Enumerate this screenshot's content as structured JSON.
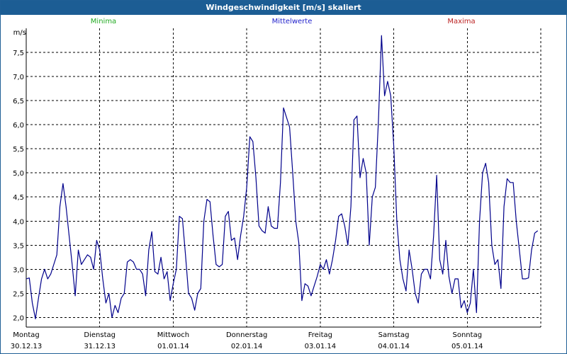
{
  "window": {
    "title": "Windgeschwindigkeit [m/s] skaliert"
  },
  "legend": [
    {
      "label": "Minima",
      "color": "#22aa22"
    },
    {
      "label": "Mittelwerte",
      "color": "#2222cc"
    },
    {
      "label": "Maxima",
      "color": "#bb2222"
    }
  ],
  "chart_data": {
    "type": "line",
    "title": "Windgeschwindigkeit [m/s] skaliert",
    "ylabel": "m/s",
    "ylim": [
      1.8,
      8.0
    ],
    "yticks": [
      2.0,
      2.5,
      3.0,
      3.5,
      4.0,
      4.5,
      5.0,
      5.5,
      6.0,
      6.5,
      7.0,
      7.5
    ],
    "ytick_labels": [
      "2,0",
      "2,5",
      "3,0",
      "3,5",
      "4,0",
      "4,5",
      "5,0",
      "5,5",
      "6,0",
      "6,5",
      "7,0",
      "7,5"
    ],
    "grid": true,
    "line_color": "#00008b",
    "days": [
      {
        "weekday": "Montag",
        "date": "30.12.13"
      },
      {
        "weekday": "Dienstag",
        "date": "31.12.13"
      },
      {
        "weekday": "Mittwoch",
        "date": "01.01.14"
      },
      {
        "weekday": "Donnerstag",
        "date": "02.01.14"
      },
      {
        "weekday": "Freitag",
        "date": "03.01.14"
      },
      {
        "weekday": "Samstag",
        "date": "04.01.14"
      },
      {
        "weekday": "Sonntag",
        "date": "05.01.14"
      }
    ],
    "x_unit": "hours since 30.12.13 00:00",
    "xlim": [
      0,
      168
    ],
    "series": [
      {
        "name": "Mittelwerte",
        "x": [
          0,
          1,
          2,
          3,
          4,
          5,
          6,
          7,
          8,
          9,
          10,
          11,
          12,
          13,
          14,
          15,
          16,
          17,
          18,
          19,
          20,
          21,
          22,
          23,
          24,
          25,
          26,
          27,
          28,
          29,
          30,
          31,
          32,
          33,
          34,
          35,
          36,
          37,
          38,
          39,
          40,
          41,
          42,
          43,
          44,
          45,
          46,
          47,
          48,
          49,
          50,
          51,
          52,
          53,
          54,
          55,
          56,
          57,
          58,
          59,
          60,
          61,
          62,
          63,
          64,
          65,
          66,
          67,
          68,
          69,
          70,
          71,
          72,
          73,
          74,
          75,
          76,
          77,
          78,
          79,
          80,
          81,
          82,
          83,
          84,
          85,
          86,
          87,
          88,
          89,
          90,
          91,
          92,
          93,
          94,
          95,
          96,
          97,
          98,
          99,
          100,
          101,
          102,
          103,
          104,
          105,
          106,
          107,
          108,
          109,
          110,
          111,
          112,
          113,
          114,
          115,
          116,
          117,
          118,
          119,
          120,
          121,
          122,
          123,
          124,
          125,
          126,
          127,
          128,
          129,
          130,
          131,
          132,
          133,
          134,
          135,
          136,
          137,
          138,
          139,
          140,
          141,
          142,
          143,
          144,
          145,
          146,
          147,
          148,
          149,
          150,
          151,
          152,
          153,
          154,
          155,
          156,
          157,
          158,
          159,
          160,
          161,
          162,
          163,
          164,
          165,
          166,
          167
        ],
        "values": [
          2.8,
          2.82,
          2.3,
          1.97,
          2.4,
          2.8,
          3.0,
          2.8,
          2.9,
          3.1,
          3.3,
          4.3,
          4.78,
          4.3,
          3.7,
          3.1,
          2.45,
          3.4,
          3.1,
          3.2,
          3.3,
          3.25,
          3.0,
          3.6,
          3.4,
          2.8,
          2.3,
          2.5,
          2.0,
          2.25,
          2.1,
          2.4,
          2.5,
          3.15,
          3.2,
          3.15,
          3.0,
          3.0,
          2.9,
          2.45,
          3.4,
          3.78,
          2.95,
          2.9,
          3.25,
          2.8,
          2.95,
          2.35,
          2.7,
          3.0,
          4.1,
          4.05,
          3.3,
          2.5,
          2.4,
          2.15,
          2.5,
          2.6,
          4.0,
          4.45,
          4.4,
          3.7,
          3.1,
          3.05,
          3.1,
          4.1,
          4.2,
          3.6,
          3.65,
          3.2,
          3.7,
          4.1,
          4.7,
          5.75,
          5.65,
          4.9,
          3.9,
          3.8,
          3.75,
          4.3,
          3.9,
          3.85,
          3.85,
          4.8,
          6.35,
          6.15,
          5.95,
          5.0,
          4.0,
          3.55,
          2.35,
          2.7,
          2.65,
          2.45,
          2.65,
          2.85,
          3.1,
          3.0,
          3.2,
          2.9,
          3.2,
          3.6,
          4.1,
          4.15,
          3.9,
          3.5,
          4.3,
          6.1,
          6.18,
          4.9,
          5.3,
          5.0,
          3.5,
          4.5,
          4.7,
          6.1,
          7.85,
          6.6,
          6.9,
          6.6,
          5.55,
          4.0,
          3.2,
          2.8,
          2.55,
          3.4,
          3.0,
          2.5,
          2.3,
          2.9,
          3.0,
          3.0,
          2.8,
          3.7,
          4.95,
          3.2,
          2.9,
          3.6,
          2.85,
          2.5,
          2.8,
          2.8,
          2.2,
          2.35,
          2.1,
          2.3,
          3.0,
          2.1,
          4.0,
          5.0,
          5.2,
          4.8,
          3.5,
          3.1,
          3.2,
          2.6,
          4.3,
          4.88,
          4.8,
          4.8,
          4.0,
          3.4,
          2.8,
          2.8,
          2.82,
          3.4,
          3.75,
          3.8
        ]
      }
    ]
  }
}
